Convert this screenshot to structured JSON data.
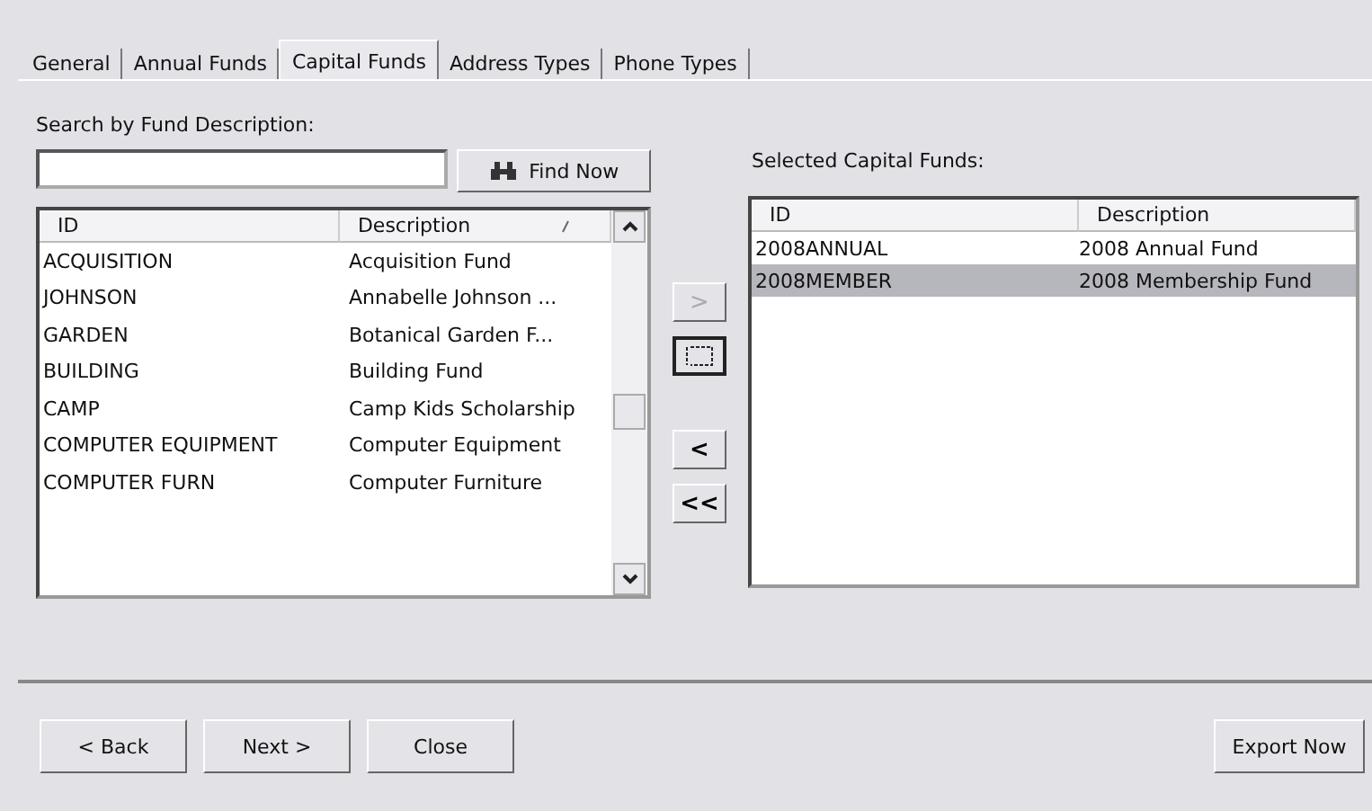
{
  "tabs": [
    {
      "label": "General",
      "selected": false
    },
    {
      "label": "Annual Funds",
      "selected": false
    },
    {
      "label": "Capital Funds",
      "selected": true
    },
    {
      "label": "Address Types",
      "selected": false
    },
    {
      "label": "Phone Types",
      "selected": false
    }
  ],
  "search": {
    "label": "Search by Fund Description:",
    "button": "Find Now"
  },
  "available": {
    "columns": [
      "ID",
      "Description"
    ],
    "rows": [
      {
        "id": "ACQUISITION",
        "description": "Acquisition Fund",
        "selected": false
      },
      {
        "id": "JOHNSON",
        "description": "Annabelle Johnson ...",
        "selected": false
      },
      {
        "id": "GARDEN",
        "description": "Botanical Garden F...",
        "selected": false
      },
      {
        "id": "BUILDING",
        "description": "Building Fund",
        "selected": false
      },
      {
        "id": "CAMP",
        "description": "Camp Kids Scholarship",
        "selected": false
      },
      {
        "id": "COMPUTER EQUIPMENT",
        "description": "Computer Equipment",
        "selected": false
      },
      {
        "id": "COMPUTER FURN",
        "description": "Computer Furniture",
        "selected": false
      }
    ]
  },
  "transfer_buttons": [
    {
      "label": ">",
      "disabled": true,
      "kind": "text"
    },
    {
      "kind": "swap",
      "disabled": false
    },
    {
      "label": "<",
      "disabled": false,
      "kind": "text"
    },
    {
      "label": "<<",
      "disabled": false,
      "kind": "text"
    }
  ],
  "selected_funds": {
    "label": "Selected Capital Funds:",
    "columns": [
      "ID",
      "Description"
    ],
    "rows": [
      {
        "id": "2008ANNUAL",
        "description": "2008 Annual Fund",
        "selected": false
      },
      {
        "id": "2008MEMBER",
        "description": "2008 Membership Fund",
        "selected": true
      }
    ]
  },
  "footer_buttons": [
    "< Back",
    "Next >",
    "Close"
  ],
  "export_button": "Export Now"
}
